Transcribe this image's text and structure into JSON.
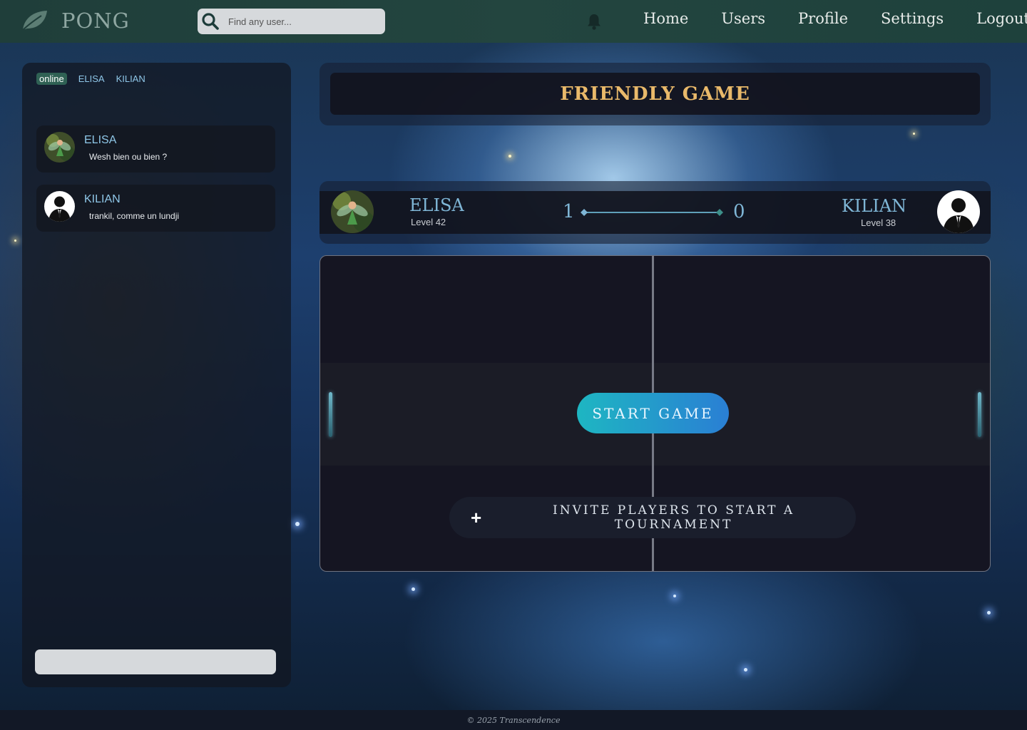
{
  "navbar": {
    "brand": "PONG",
    "search_placeholder": "Find any user...",
    "links": [
      "Home",
      "Users",
      "Profile",
      "Settings",
      "Logout"
    ]
  },
  "chat": {
    "tabs": [
      "online",
      "ELISA",
      "KILIAN"
    ],
    "conversations": [
      {
        "name": "ELISA",
        "message": "Wesh bien ou bien ?"
      },
      {
        "name": "KILIAN",
        "message": "trankil, comme un lundji"
      }
    ]
  },
  "game": {
    "title": "FRIENDLY GAME",
    "player1": {
      "name": "ELISA",
      "level": "Level 42",
      "score": "1"
    },
    "player2": {
      "name": "KILIAN",
      "level": "Level 38",
      "score": "0"
    },
    "start_label": "START GAME",
    "invite_label": "Invite players to start a tournament"
  },
  "footer": {
    "text": "© 2025 Transcendence"
  },
  "colors": {
    "accent": "#7fb6d6",
    "title_gold": "#e9b96a",
    "start_gradient": [
      "#1eb6c2",
      "#2a7fd4"
    ],
    "navbar": "#23453f"
  },
  "icons": [
    "leaf-icon",
    "search-icon",
    "bell-icon",
    "plus-icon"
  ]
}
